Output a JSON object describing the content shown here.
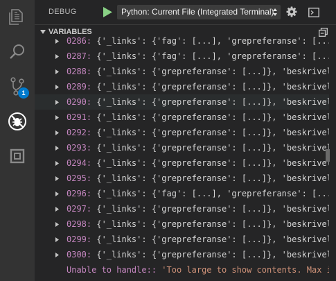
{
  "activity_bar": {
    "items": [
      {
        "name": "explorer",
        "icon": "files-icon"
      },
      {
        "name": "search",
        "icon": "search-icon"
      },
      {
        "name": "source-control",
        "icon": "source-control-icon",
        "badge": "1"
      },
      {
        "name": "debug",
        "icon": "debug-icon",
        "active": true
      },
      {
        "name": "extensions",
        "icon": "extensions-icon"
      }
    ]
  },
  "toolbar": {
    "title": "DEBUG",
    "configuration": "Python: Current File (Integrated Terminal)",
    "run_icon": "play-icon",
    "settings_icon": "gear-icon",
    "console_icon": "debug-console-icon"
  },
  "variables": {
    "title": "VARIABLES",
    "collapse_icon": "collapse-all-icon",
    "rows": [
      {
        "index": "0286:",
        "value": "{'_links': {'fag': [...], 'grepreferanse': [...], '"
      },
      {
        "index": "0287:",
        "value": "{'_links': {'fag': [...], 'grepreferanse': [...], '"
      },
      {
        "index": "0288:",
        "value": "{'_links': {'grepreferanse': [...]}, 'beskrivelse':"
      },
      {
        "index": "0289:",
        "value": "{'_links': {'grepreferanse': [...]}, 'beskrivelse':"
      },
      {
        "index": "0290:",
        "value": "{'_links': {'grepreferanse': [...]}, 'beskrivelse':"
      },
      {
        "index": "0291:",
        "value": "{'_links': {'grepreferanse': [...]}, 'beskrivelse':"
      },
      {
        "index": "0292:",
        "value": "{'_links': {'grepreferanse': [...]}, 'beskrivelse':"
      },
      {
        "index": "0293:",
        "value": "{'_links': {'grepreferanse': [...]}, 'beskrivelse':"
      },
      {
        "index": "0294:",
        "value": "{'_links': {'grepreferanse': [...]}, 'beskrivelse':"
      },
      {
        "index": "0295:",
        "value": "{'_links': {'grepreferanse': [...]}, 'beskrivelse':"
      },
      {
        "index": "0296:",
        "value": "{'_links': {'fag': [...], 'grepreferanse': [...], '"
      },
      {
        "index": "0297:",
        "value": "{'_links': {'grepreferanse': [...]}, 'beskrivelse':"
      },
      {
        "index": "0298:",
        "value": "{'_links': {'grepreferanse': [...]}, 'beskrivelse':"
      },
      {
        "index": "0299:",
        "value": "{'_links': {'grepreferanse': [...]}, 'beskrivelse':"
      },
      {
        "index": "0300:",
        "value": "{'_links': {'grepreferanse': [...]}, 'beskrivelse':"
      }
    ],
    "message_label": "Unable to handle::",
    "message_value": " 'Too large to show contents. Max items"
  }
}
